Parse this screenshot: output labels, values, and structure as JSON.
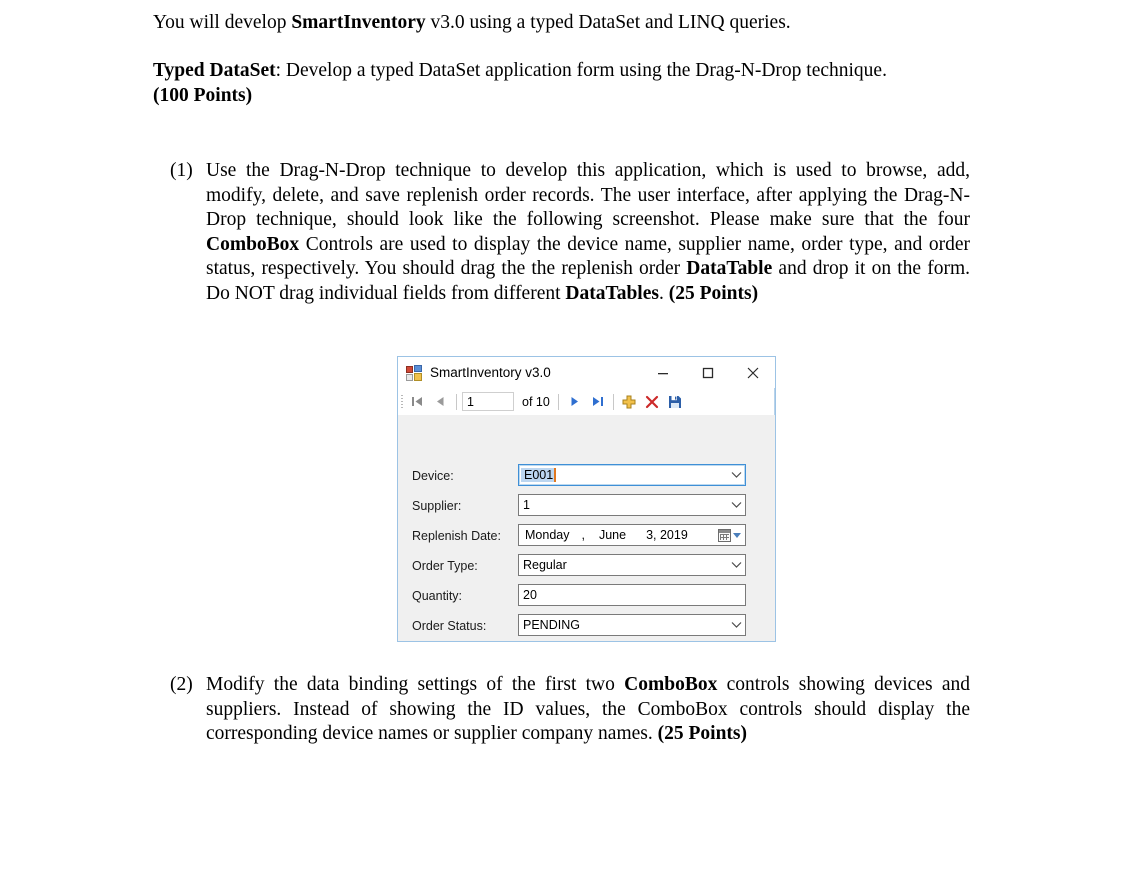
{
  "document": {
    "intro_line_1": {
      "pre": "You will develop ",
      "bold": "SmartInventory",
      "post": " v3.0 using a typed DataSet and LINQ queries."
    },
    "intro_line_2": {
      "bold_lead": "Typed DataSet",
      "mid": ": Develop a typed DataSet application form using the Drag-N-Drop technique. ",
      "bold_points": "(100 Points)"
    },
    "items": [
      {
        "number": "(1)",
        "text_parts": [
          {
            "text": "Use the Drag-N-Drop technique to develop this application, which is used to browse, add, modify, delete, and save replenish order records. The user interface, after applying the Drag-N-Drop technique, should look like the following screenshot. Please make sure that the four ",
            "bold": false
          },
          {
            "text": "ComboBox",
            "bold": true
          },
          {
            "text": " Controls are used to display the device name, supplier name, order type, and order status, respectively. You should drag the the replenish order ",
            "bold": false
          },
          {
            "text": "DataTable",
            "bold": true
          },
          {
            "text": " and drop it on the form. Do NOT drag individual fields from different ",
            "bold": false
          },
          {
            "text": "DataTables",
            "bold": true
          },
          {
            "text": ".  ",
            "bold": false
          },
          {
            "text": "(25 Points)",
            "bold": true
          }
        ]
      },
      {
        "number": "(2)",
        "text_parts": [
          {
            "text": "Modify the data binding settings of the first two ",
            "bold": false
          },
          {
            "text": "ComboBox",
            "bold": true
          },
          {
            "text": " controls showing devices and suppliers. Instead of showing the ID values, the ComboBox controls should display the corresponding device names or supplier company names. ",
            "bold": false
          },
          {
            "text": "(25 Points)",
            "bold": true
          }
        ]
      }
    ]
  },
  "winform": {
    "title": "SmartInventory v3.0",
    "app_icon": "winforms-app-icon",
    "window_controls": {
      "minimize": "minimize-icon",
      "maximize": "maximize-icon",
      "close": "close-icon"
    },
    "toolbar": {
      "move_first_icon": "move-first-icon",
      "move_previous_icon": "move-previous-icon",
      "position_value": "1",
      "count_label": "of 10",
      "move_next_icon": "move-next-icon",
      "move_last_icon": "move-last-icon",
      "add_new_icon": "add-plus-icon",
      "delete_icon": "delete-x-icon",
      "save_icon": "save-floppy-icon"
    },
    "fields": [
      {
        "label": "Device:",
        "value": "E001",
        "control": "combobox",
        "focused": true,
        "selected_text": true
      },
      {
        "label": "Supplier:",
        "value": "1",
        "control": "combobox",
        "focused": false,
        "selected_text": false
      },
      {
        "label": "Replenish Date:",
        "control": "datetimepicker",
        "date": {
          "day_name": "Monday",
          "separator": ",",
          "month": "June",
          "day_year": "3, 2019"
        },
        "calendar_icon": "calendar-icon",
        "dropdown_icon": "dropdown-triangle-icon"
      },
      {
        "label": "Order Type:",
        "value": "Regular",
        "control": "combobox",
        "focused": false,
        "selected_text": false
      },
      {
        "label": "Quantity:",
        "value": "20",
        "control": "textbox",
        "focused": false,
        "selected_text": false
      },
      {
        "label": "Order Status:",
        "value": "PENDING",
        "control": "combobox",
        "focused": false,
        "selected_text": false
      }
    ]
  },
  "colors": {
    "form_background": "#f0f0f0",
    "form_border": "#9cc3e5",
    "titlebar_background": "#ffffff",
    "nav_arrow_blue": "#2f6fd0",
    "nav_arrow_gray": "#8a8a8a",
    "add_icon_yellow": "#f2c14b",
    "delete_icon_red": "#cc2a2a",
    "save_icon_blue": "#2c5fa8",
    "selection_highlight": "#bcd6f0",
    "caret_orange": "#e07820",
    "focus_border": "#3f8fd6"
  }
}
